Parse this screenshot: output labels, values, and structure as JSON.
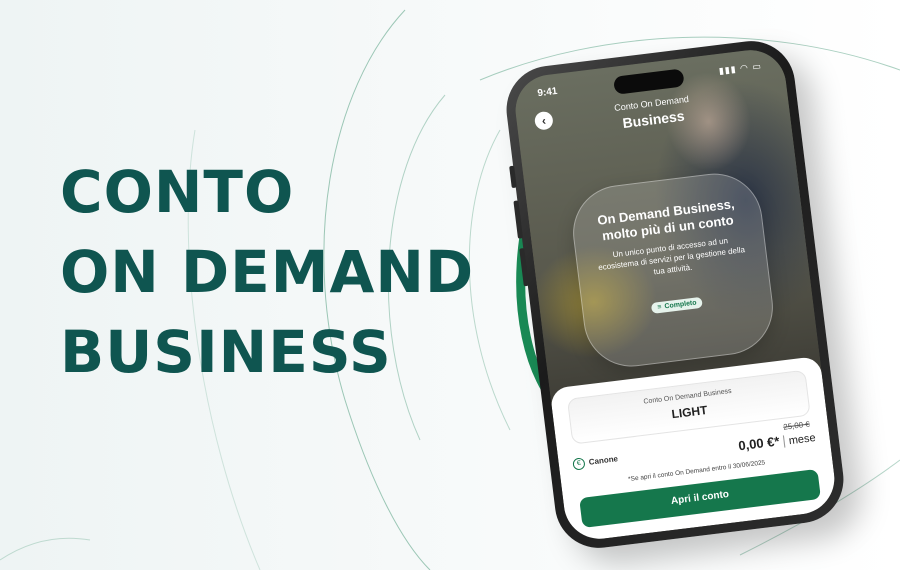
{
  "headline": {
    "line1": "CONTO",
    "line2": "ON DEMAND",
    "line3": "BUSINESS"
  },
  "colors": {
    "brand_dark": "#0f5550",
    "brand_green": "#15774c",
    "ring_green": "#1a8a55"
  },
  "phone": {
    "status_time": "9:41",
    "status_icons": "signal-wifi-battery",
    "back_icon": "chevron-left-icon",
    "header_subtitle": "Conto On Demand",
    "header_title": "Business",
    "card": {
      "title": "On Demand Business, molto più di un conto",
      "text": "Un unico punto di accesso ad un ecosistema di servizi per la gestione della tua attività.",
      "badge_icon": "list-icon",
      "badge": "Completo"
    },
    "carousel": {
      "active": 1,
      "count": 3
    },
    "plan": {
      "name": "Conto On Demand Business",
      "level": "LIGHT"
    },
    "price": {
      "icon": "euro-icon",
      "label": "Canone",
      "old": "25,00 €",
      "new": "0,00 €*",
      "separator": "|",
      "period": "mese"
    },
    "note": "*Se apri il conto On Demand entro il 30/06/2025",
    "cta": "Apri il conto"
  }
}
